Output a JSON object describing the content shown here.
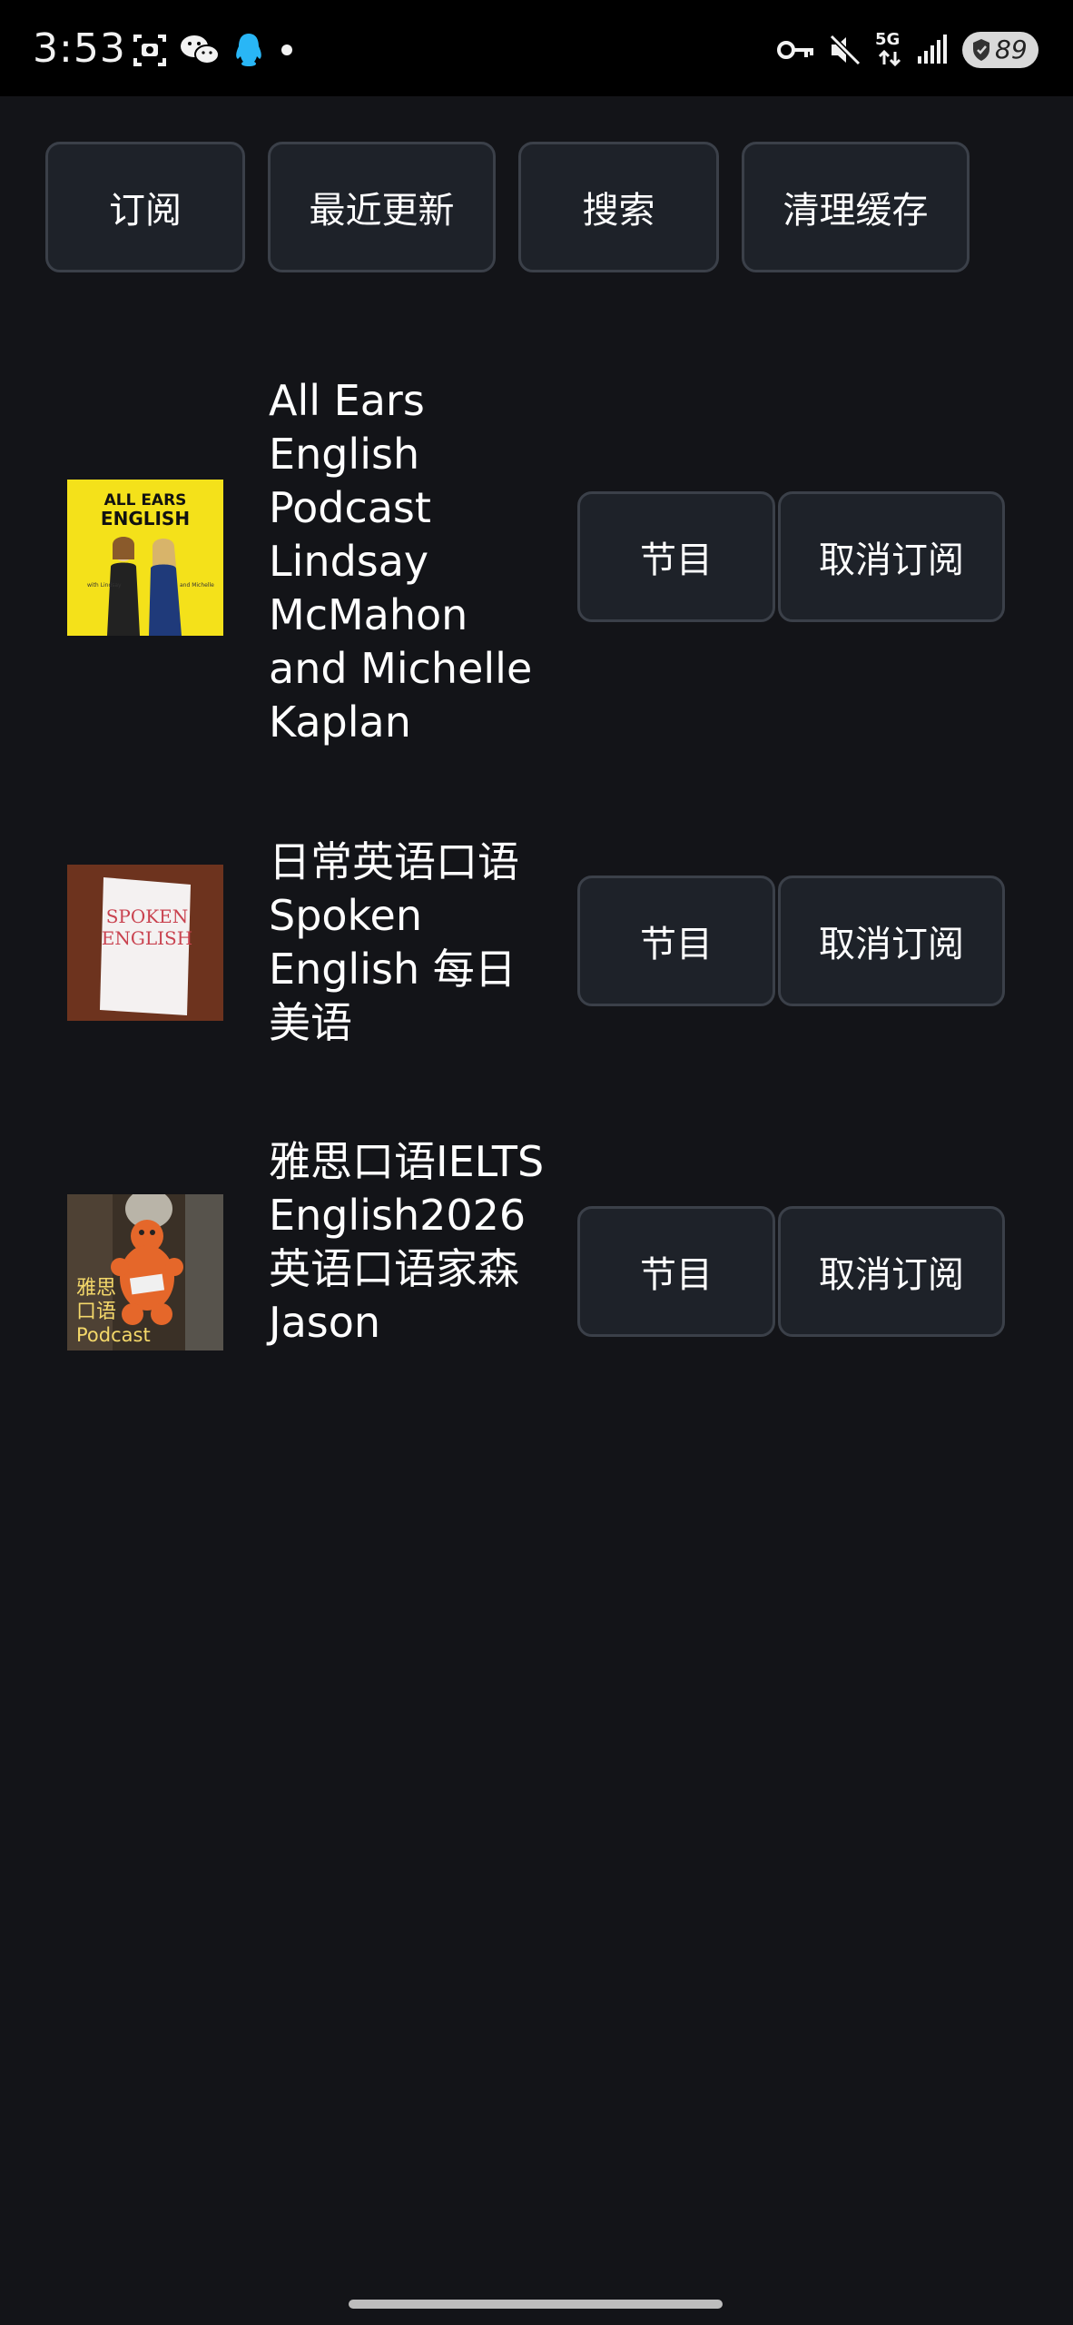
{
  "status_bar": {
    "time": "3:53",
    "network": "5G",
    "battery": "89",
    "left_icons": [
      "screenshot-icon",
      "wechat-icon",
      "qq-icon",
      "dot-icon"
    ],
    "right_icons": [
      "vpn-key-icon",
      "mute-icon",
      "5g-signal-icon",
      "signal-bars-icon",
      "battery-icon"
    ]
  },
  "toolbar": {
    "subscribe_label": "订阅",
    "recent_label": "最近更新",
    "search_label": "搜索",
    "clear_cache_label": "清理缓存"
  },
  "podcasts": [
    {
      "title": "All Ears English Podcast Lindsay McMahon and Michelle Kaplan",
      "cover_text": [
        "ALL EARS",
        "ENGLISH"
      ],
      "cover_color": "#f4e11a",
      "episodes_label": "节目",
      "unsubscribe_label": "取消订阅"
    },
    {
      "title": "日常英语口语 Spoken English 每日美语",
      "cover_text": [
        "SPOKEN",
        "ENGLISH"
      ],
      "cover_color": "#7a3a22",
      "episodes_label": "节目",
      "unsubscribe_label": "取消订阅"
    },
    {
      "title": "雅思口语IELTS English2026 英语口语家森Jason",
      "cover_text": [
        "雅思",
        "口语",
        "Podcast"
      ],
      "cover_color": "#3a3026",
      "episodes_label": "节目",
      "unsubscribe_label": "取消订阅"
    }
  ]
}
